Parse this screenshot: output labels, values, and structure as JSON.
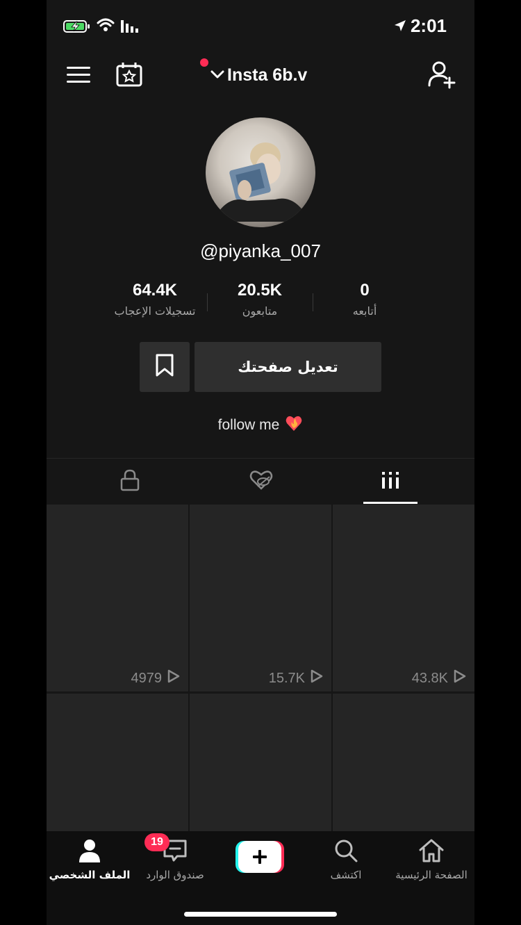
{
  "status_bar": {
    "time": "2:01",
    "battery": "charging",
    "icons": [
      "battery-icon",
      "wifi-icon",
      "signal-icon",
      "location-icon"
    ]
  },
  "header": {
    "account_name": "Insta 6b.v",
    "icons": [
      "menu-icon",
      "calendar-star-icon",
      "chevron-down-icon",
      "add-user-icon"
    ]
  },
  "profile": {
    "username": "@piyanka_007",
    "stats": [
      {
        "value": "64.4K",
        "label": "تسجيلات الإعجاب"
      },
      {
        "value": "20.5K",
        "label": "متابعون"
      },
      {
        "value": "0",
        "label": "أتابعه"
      }
    ],
    "edit_button": "تعديل صفحتك",
    "bio": "follow me",
    "bio_emoji": "❤️‍🔥"
  },
  "tabs": [
    {
      "name": "private-videos",
      "icon": "lock-icon"
    },
    {
      "name": "liked-videos",
      "icon": "heart-hidden-icon"
    },
    {
      "name": "videos",
      "icon": "grid-icon",
      "active": true
    }
  ],
  "videos": [
    {
      "views": "43.8K"
    },
    {
      "views": "15.7K"
    },
    {
      "views": "4979"
    },
    {
      "views": ""
    },
    {
      "views": ""
    },
    {
      "views": ""
    }
  ],
  "bottom_nav": [
    {
      "label": "الصفحة الرئيسية",
      "icon": "home-icon"
    },
    {
      "label": "اكتشف",
      "icon": "search-icon"
    },
    {
      "label": "",
      "icon": "plus-icon"
    },
    {
      "label": "صندوق الوارد",
      "icon": "inbox-icon",
      "badge": "19"
    },
    {
      "label": "الملف الشخصي",
      "icon": "profile-icon",
      "active": true
    }
  ],
  "colors": {
    "background": "#161616",
    "accent": "#fe2c55",
    "cyan": "#25f4ee",
    "tile": "#252525"
  }
}
